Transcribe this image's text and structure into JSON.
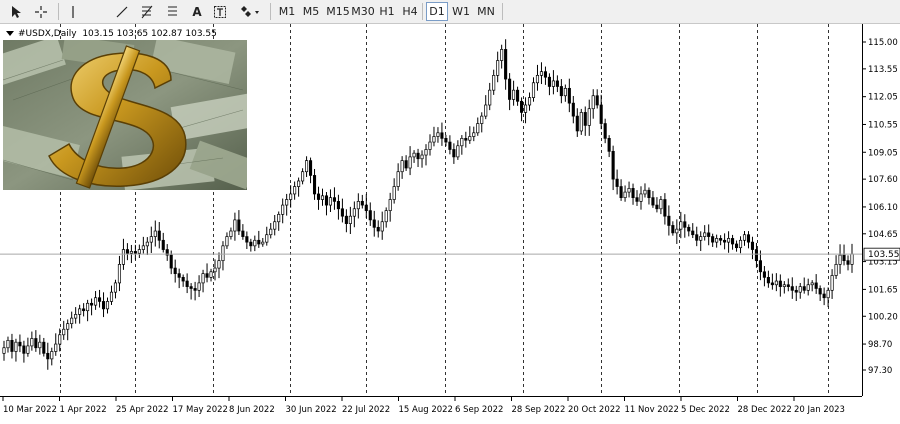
{
  "toolbar": {
    "tools": [
      "cursor-icon",
      "crosshair-icon",
      "vertical-line-icon",
      "trendline-icon",
      "fibonacci-icon",
      "text-icon",
      "text-label-icon",
      "shapes-icon"
    ],
    "timeframes": [
      "M1",
      "M5",
      "M15",
      "M30",
      "H1",
      "H4",
      "D1",
      "W1",
      "MN"
    ],
    "active_timeframe": "D1"
  },
  "chart_data": {
    "type": "candlestick",
    "symbol": "#USDX,Daily",
    "ohlc_header": "103.15 103.65 102.87 103.55",
    "current_price": "103.55",
    "y_ticks": [
      "115.00",
      "113.55",
      "112.05",
      "110.55",
      "109.05",
      "107.60",
      "106.10",
      "104.65",
      "103.15",
      "101.65",
      "100.20",
      "98.70",
      "97.30"
    ],
    "ylim": [
      97.3,
      115.5
    ],
    "x_ticks": [
      "10 Mar 2022",
      "1 Apr 2022",
      "25 Apr 2022",
      "17 May 2022",
      "8 Jun 2022",
      "30 Jun 2022",
      "22 Jul 2022",
      "15 Aug 2022",
      "6 Sep 2022",
      "28 Sep 2022",
      "20 Oct 2022",
      "11 Nov 2022",
      "5 Dec 2022",
      "28 Dec 2022",
      "20 Jan 2023"
    ],
    "grid": "vertical dashed separators",
    "close_series": [
      98.5,
      98.9,
      98.3,
      98.8,
      98.6,
      98.2,
      98.6,
      99.0,
      98.5,
      98.8,
      98.2,
      97.9,
      98.3,
      98.7,
      99.2,
      99.5,
      99.8,
      100.1,
      100.3,
      100.6,
      100.5,
      100.9,
      100.8,
      101.2,
      101.0,
      100.6,
      101.0,
      101.5,
      102.0,
      103.0,
      103.8,
      103.6,
      103.7,
      103.6,
      103.8,
      104.0,
      104.2,
      104.5,
      104.8,
      104.3,
      103.8,
      103.5,
      102.8,
      102.5,
      102.3,
      102.1,
      101.8,
      101.7,
      101.6,
      102.0,
      102.5,
      102.3,
      102.6,
      102.8,
      103.2,
      104.0,
      104.5,
      104.8,
      105.4,
      104.8,
      104.5,
      104.2,
      104.0,
      104.3,
      104.1,
      104.2,
      104.6,
      104.9,
      105.3,
      105.7,
      106.2,
      106.5,
      106.8,
      107.2,
      107.5,
      108.0,
      108.6,
      107.8,
      106.8,
      106.5,
      106.7,
      106.2,
      106.6,
      106.4,
      106.0,
      105.6,
      105.2,
      105.6,
      106.0,
      106.4,
      106.2,
      105.9,
      105.4,
      105.0,
      104.8,
      105.3,
      105.9,
      106.5,
      107.2,
      108.0,
      108.6,
      108.2,
      108.8,
      109.0,
      108.7,
      108.9,
      109.2,
      109.6,
      109.9,
      110.1,
      109.8,
      109.6,
      109.2,
      108.8,
      109.4,
      109.8,
      109.7,
      109.9,
      110.1,
      110.6,
      111.0,
      111.6,
      112.4,
      113.2,
      114.0,
      114.6,
      113.0,
      111.9,
      112.4,
      111.8,
      111.2,
      111.6,
      112.0,
      112.8,
      113.2,
      113.4,
      113.1,
      112.6,
      112.9,
      112.6,
      112.1,
      112.5,
      111.7,
      111.0,
      110.2,
      111.2,
      110.5,
      111.4,
      112.1,
      111.6,
      110.6,
      109.8,
      109.1,
      107.6,
      107.2,
      106.6,
      106.9,
      107.1,
      106.6,
      106.4,
      106.8,
      107.0,
      106.6,
      106.2,
      106.0,
      106.5,
      105.6,
      105.1,
      104.7,
      104.9,
      105.3,
      105.0,
      104.8,
      104.6,
      104.3,
      104.5,
      104.7,
      104.5,
      104.2,
      104.4,
      104.3,
      104.2,
      104.4,
      104.1,
      103.9,
      104.3,
      104.6,
      104.2,
      103.8,
      103.2,
      102.6,
      102.3,
      102.0,
      101.9,
      102.1,
      101.8,
      101.9,
      101.8,
      101.6,
      101.5,
      101.8,
      101.6,
      101.9,
      102.0,
      101.7,
      101.4,
      101.2,
      101.6,
      102.4,
      103.0,
      103.5,
      103.2,
      103.0,
      103.55
    ]
  }
}
